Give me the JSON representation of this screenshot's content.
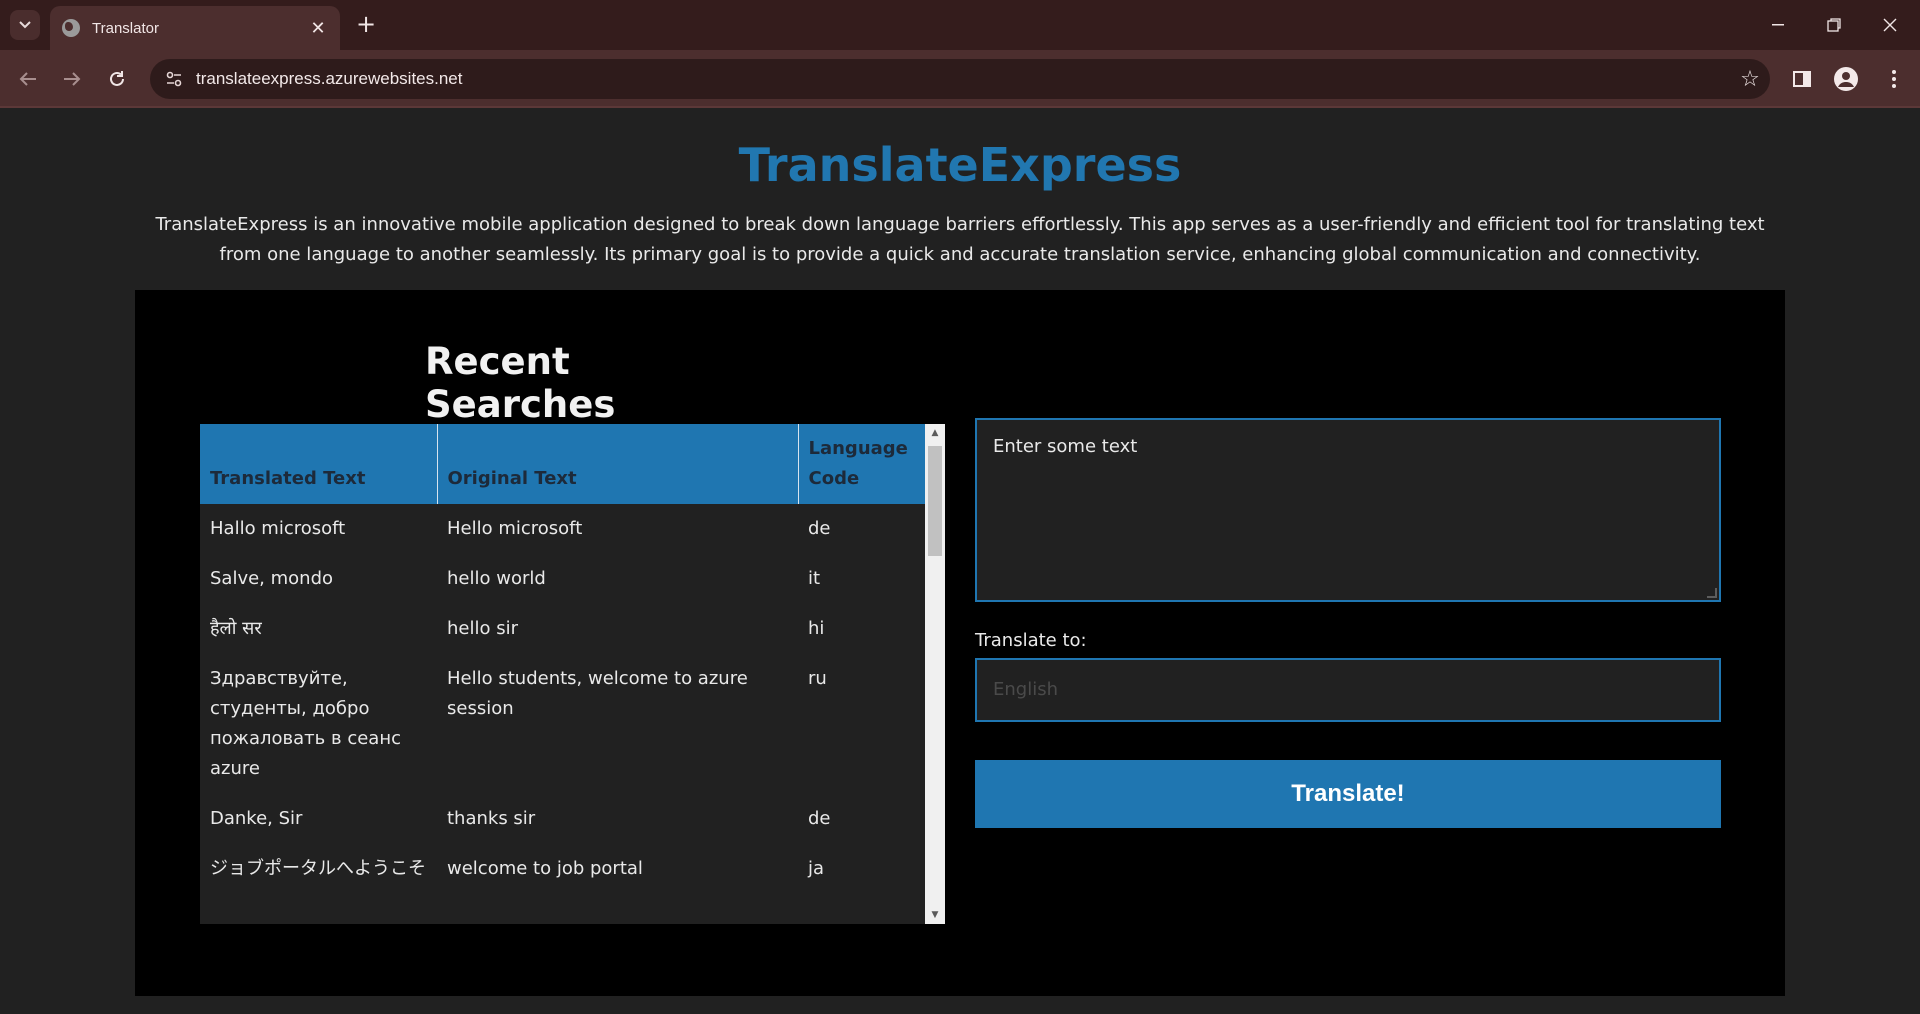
{
  "browser": {
    "tab_title": "Translator",
    "url": "translateexpress.azurewebsites.net"
  },
  "header": {
    "title": "TranslateExpress",
    "description": "TranslateExpress is an innovative mobile application designed to break down language barriers effortlessly. This app serves as a user-friendly and efficient tool for translating text from one language to another seamlessly. Its primary goal is to provide a quick and accurate translation service, enhancing global communication and connectivity."
  },
  "recent": {
    "title": "Recent Searches",
    "columns": [
      "Translated Text",
      "Original Text",
      "Language Code"
    ],
    "rows": [
      {
        "translated": "Hallo microsoft",
        "original": "Hello microsoft",
        "code": "de"
      },
      {
        "translated": "Salve, mondo",
        "original": "hello world",
        "code": "it"
      },
      {
        "translated": "हैलो सर",
        "original": "hello sir",
        "code": "hi"
      },
      {
        "translated": "Здравствуйте, студенты, добро пожаловать в сеанс azure",
        "original": "Hello students, welcome to azure session",
        "code": "ru"
      },
      {
        "translated": "Danke, Sir",
        "original": "thanks sir",
        "code": "de"
      },
      {
        "translated": "ジョブポータルへようこそ",
        "original": "welcome to job portal",
        "code": "ja"
      }
    ]
  },
  "form": {
    "text_placeholder": "Enter some text",
    "translate_to_label": "Translate to:",
    "language_placeholder": "English",
    "button_label": "Translate!"
  }
}
